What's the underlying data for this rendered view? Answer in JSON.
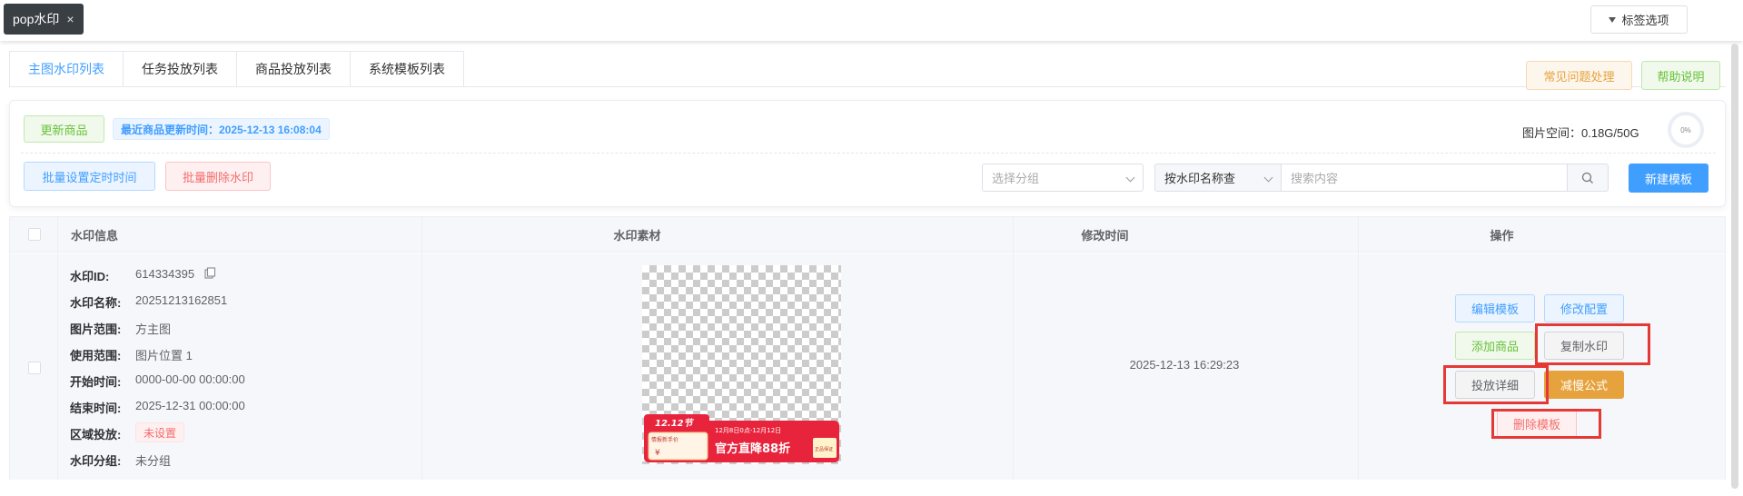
{
  "top_tab": {
    "label": "pop水印",
    "close": "×"
  },
  "tag_options": {
    "label": "标签选项"
  },
  "sub_tabs": [
    {
      "label": "主图水印列表",
      "active": true
    },
    {
      "label": "任务投放列表",
      "active": false
    },
    {
      "label": "商品投放列表",
      "active": false
    },
    {
      "label": "系统模板列表",
      "active": false
    }
  ],
  "header_buttons": {
    "faq": "常见问题处理",
    "help": "帮助说明"
  },
  "panel": {
    "update_button": "更新商品",
    "last_update": "最近商品更新时间：2025-12-13 16:08:04",
    "space_label": "图片空间：0.18G/50G",
    "space_percent": "0%",
    "batch_time_button": "批量设置定时时间",
    "batch_delete_button": "批量删除水印",
    "group_select_placeholder": "选择分组",
    "search_type": "按水印名称查",
    "search_placeholder": "搜索内容",
    "new_template_button": "新建模板"
  },
  "table": {
    "headers": {
      "info": "水印信息",
      "material": "水印素材",
      "modified": "修改时间",
      "actions": "操作"
    },
    "rows": [
      {
        "fields": [
          {
            "k": "水印ID:",
            "v": "614334395"
          },
          {
            "k": "水印名称:",
            "v": "20251213162851"
          },
          {
            "k": "图片范围:",
            "v": "方主图"
          },
          {
            "k": "使用范围:",
            "v": "图片位置 1"
          },
          {
            "k": "开始时间:",
            "v": "0000-00-00 00:00:00"
          },
          {
            "k": "结束时间:",
            "v": "2025-12-31 00:00:00"
          },
          {
            "k": "区域投放:",
            "v": "未设置"
          },
          {
            "k": "水印分组:",
            "v": "未分组"
          }
        ],
        "modified": "2025-12-13 16:29:23",
        "actions": {
          "edit": "编辑模板",
          "config": "修改配置",
          "add_goods": "添加商品",
          "copy": "复制水印",
          "detail": "投放详细",
          "formula": "减慢公式",
          "delete": "删除模板"
        },
        "banner": {
          "festival": "12.12节",
          "subtitle": "12月8日0点-12月12日",
          "coupon": "情报新手价",
          "currency": "¥",
          "headline": "官方直降88折",
          "badge": "正品保证"
        }
      }
    ]
  },
  "colors": {
    "primary": "#409eff",
    "highlight_box": "#e53935",
    "banner_red": "#e8243c"
  }
}
